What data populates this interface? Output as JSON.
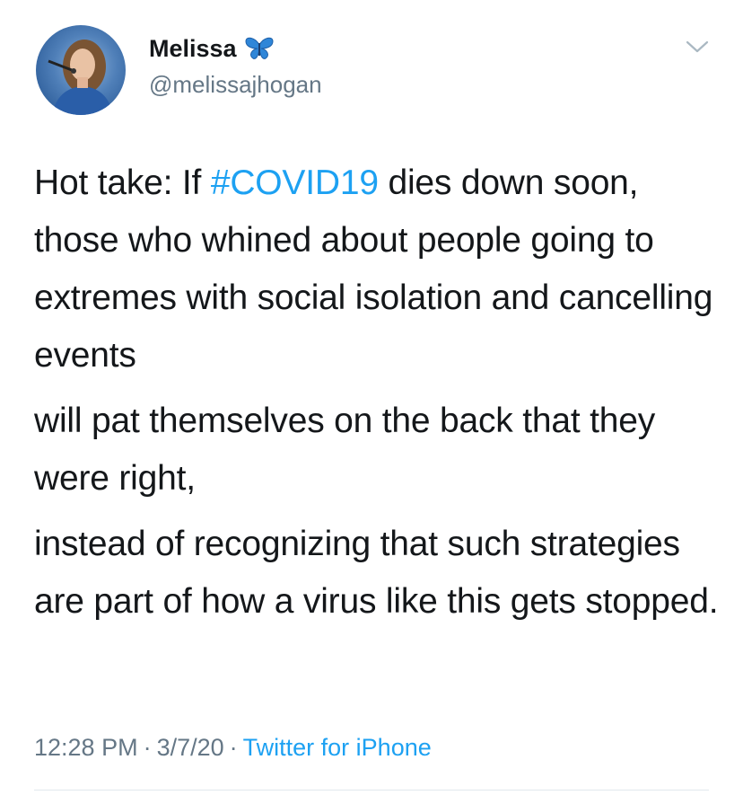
{
  "author": {
    "display_name": "Melissa",
    "handle": "@melissajhogan",
    "badge_icon": "butterfly-icon"
  },
  "menu_icon": "chevron-down-icon",
  "tweet": {
    "para1_before": "Hot take: If ",
    "hashtag": "#COVID19",
    "para1_after": " dies down soon, those who whined about people going to extremes with social isolation and cancelling events",
    "para2": "will pat themselves on the back that they were right,",
    "para3": "instead of recognizing that such strategies are part of how a virus like this gets stopped."
  },
  "meta": {
    "time": "12:28 PM",
    "date": "3/7/20",
    "separator": "·",
    "source": "Twitter for iPhone"
  },
  "colors": {
    "link": "#1da1f2",
    "secondary_text": "#657786",
    "primary_text": "#14171a",
    "divider": "#e1e8ed"
  }
}
